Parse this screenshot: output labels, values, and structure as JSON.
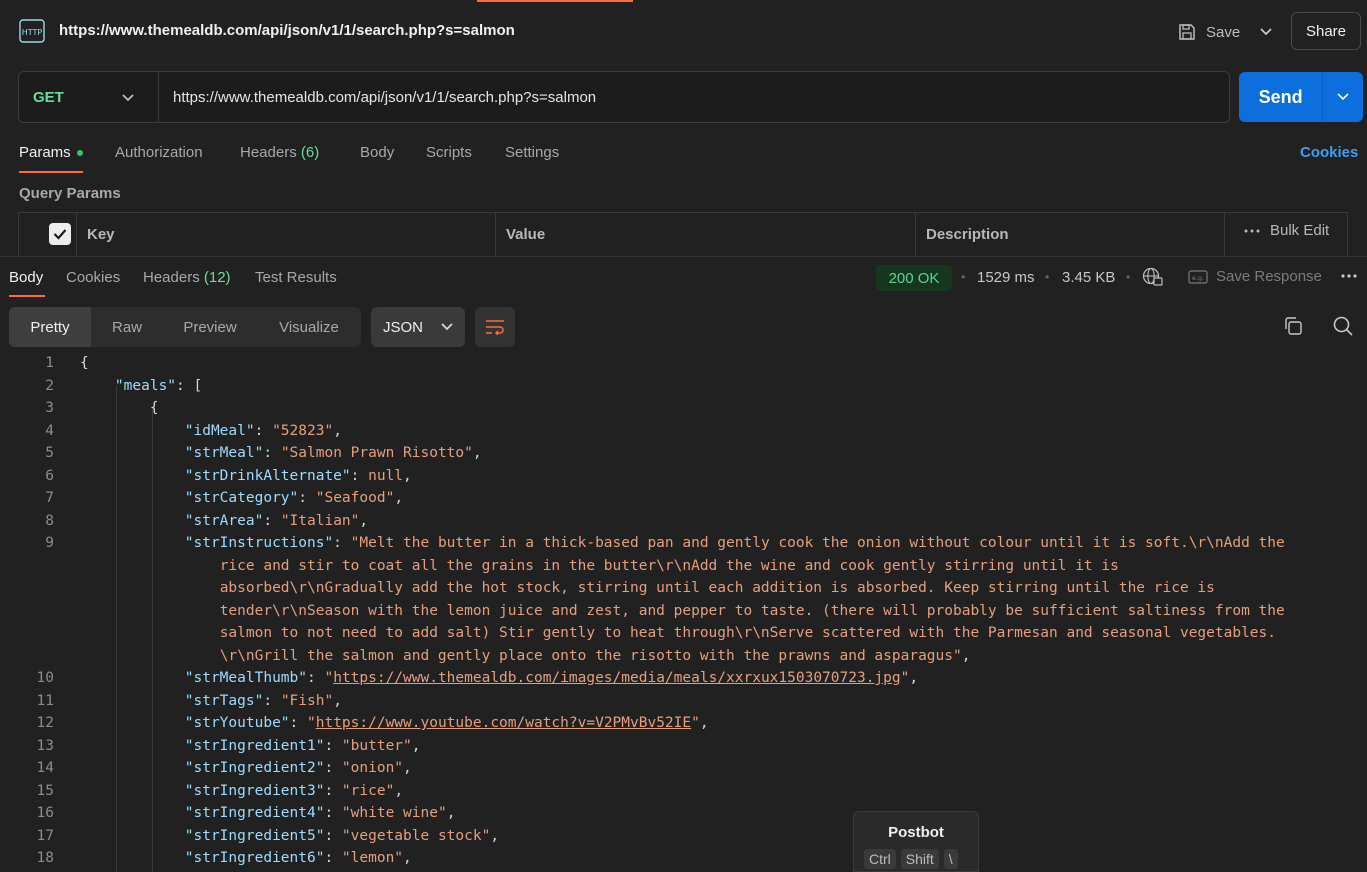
{
  "titlebar": {
    "icon": "http-icon",
    "icon_text": "HTTP",
    "title": "https://www.themealdb.com/api/json/v1/1/search.php?s=salmon",
    "save_label": "Save",
    "share_label": "Share"
  },
  "request": {
    "method": "GET",
    "url": "https://www.themealdb.com/api/json/v1/1/search.php?s=salmon",
    "send_label": "Send"
  },
  "request_tabs": {
    "params": "Params",
    "authorization": "Authorization",
    "headers": "Headers",
    "headers_count": "(6)",
    "body": "Body",
    "scripts": "Scripts",
    "settings": "Settings",
    "cookies": "Cookies"
  },
  "query_params": {
    "title": "Query Params",
    "columns": [
      "Key",
      "Value",
      "Description"
    ],
    "bulk_edit": "Bulk Edit"
  },
  "response_tabs": {
    "body": "Body",
    "cookies": "Cookies",
    "headers": "Headers",
    "headers_count": "(12)",
    "test_results": "Test Results"
  },
  "response_meta": {
    "status": "200 OK",
    "time": "1529 ms",
    "size": "3.45 KB",
    "save_response": "Save Response",
    "status_color": "#58d68d"
  },
  "view_tabs": [
    "Pretty",
    "Raw",
    "Preview",
    "Visualize"
  ],
  "format": "JSON",
  "code": {
    "line_numbers": [
      "1",
      "2",
      "3",
      "4",
      "5",
      "6",
      "7",
      "8",
      "9",
      "",
      "",
      "",
      "",
      "",
      "10",
      "11",
      "12",
      "13",
      "14",
      "15",
      "16",
      "17",
      "18"
    ],
    "meals_key": "\"meals\"",
    "fields": [
      {
        "key": "\"idMeal\"",
        "value": "\"52823\""
      },
      {
        "key": "\"strMeal\"",
        "value": "\"Salmon Prawn Risotto\""
      },
      {
        "key": "\"strDrinkAlternate\"",
        "value": "null"
      },
      {
        "key": "\"strCategory\"",
        "value": "\"Seafood\""
      },
      {
        "key": "\"strArea\"",
        "value": "\"Italian\""
      },
      {
        "key": "\"strInstructions\"",
        "value": "\"Melt the butter in a thick-based pan and gently cook the onion without colour until it is soft.\\r\\nAdd the"
      },
      {
        "key": "",
        "value": "rice and stir to coat all the grains in the butter\\r\\nAdd the wine and cook gently stirring until it is"
      },
      {
        "key": "",
        "value": "absorbed\\r\\nGradually add the hot stock, stirring until each addition is absorbed. Keep stirring until the rice is"
      },
      {
        "key": "",
        "value": "tender\\r\\nSeason with the lemon juice and zest, and pepper to taste. (there will probably be sufficient saltiness from the"
      },
      {
        "key": "",
        "value": "salmon to not need to add salt) Stir gently to heat through\\r\\nServe scattered with the Parmesan and seasonal vegetables."
      },
      {
        "key": "",
        "value": "\\r\\nGrill the salmon and gently place onto the risotto with the prawns and asparagus\""
      },
      {
        "key": "\"strMealThumb\"",
        "value": "https://www.themealdb.com/images/media/meals/xxrxux1503070723.jpg"
      },
      {
        "key": "\"strTags\"",
        "value": "\"Fish\""
      },
      {
        "key": "\"strYoutube\"",
        "value": "https://www.youtube.com/watch?v=V2PMvBv52IE"
      },
      {
        "key": "\"strIngredient1\"",
        "value": "\"butter\""
      },
      {
        "key": "\"strIngredient2\"",
        "value": "\"onion\""
      },
      {
        "key": "\"strIngredient3\"",
        "value": "\"rice\""
      },
      {
        "key": "\"strIngredient4\"",
        "value": "\"white wine\""
      },
      {
        "key": "\"strIngredient5\"",
        "value": "\"vegetable stock\""
      },
      {
        "key": "\"strIngredient6\"",
        "value": "\"lemon\""
      }
    ]
  },
  "postbot": {
    "title": "Postbot",
    "keys": [
      "Ctrl",
      "Shift",
      "\\"
    ]
  },
  "colors": {
    "accent": "#ff6c37",
    "send": "#0d6fde",
    "method_get": "#6bdd9a",
    "json_key": "#9cdcfe",
    "json_string": "#e59f7d"
  }
}
